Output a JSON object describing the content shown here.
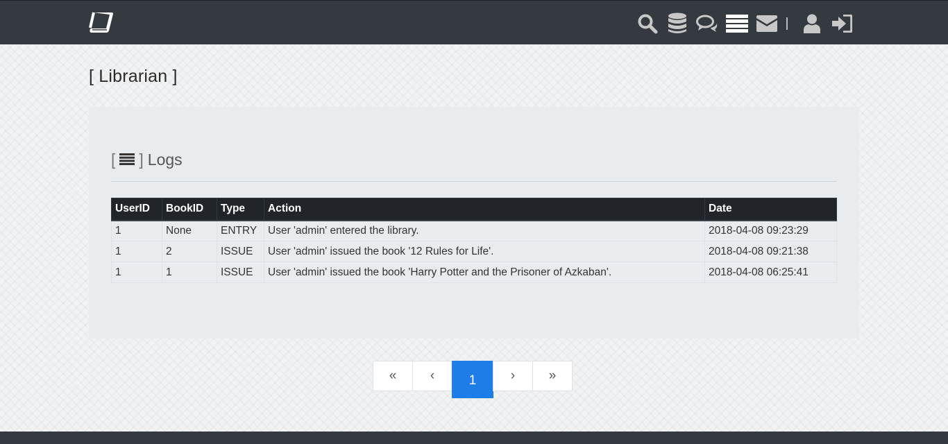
{
  "navbar": {
    "icons": [
      "book-logo-icon",
      "search-icon",
      "database-icon",
      "comments-icon",
      "list-icon",
      "envelope-icon",
      "user-icon",
      "sign-in-icon"
    ],
    "separator": "|"
  },
  "page": {
    "title": "[ Librarian ]"
  },
  "logs": {
    "open_bracket": "[",
    "close_bracket": "]",
    "title": "Logs",
    "columns": [
      "UserID",
      "BookID",
      "Type",
      "Action",
      "Date"
    ],
    "rows": [
      [
        "1",
        "None",
        "ENTRY",
        "User 'admin' entered the library.",
        "2018-04-08 09:23:29"
      ],
      [
        "1",
        "2",
        "ISSUE",
        "User 'admin' issued the book '12 Rules for Life'.",
        "2018-04-08 09:21:38"
      ],
      [
        "1",
        "1",
        "ISSUE",
        "User 'admin' issued the book 'Harry Potter and the Prisoner of Azkaban'.",
        "2018-04-08 06:25:41"
      ]
    ]
  },
  "pagination": {
    "first": "«",
    "prev": "‹",
    "current": "1",
    "next": "›",
    "last": "»"
  },
  "colors": {
    "navbar": "#343a40",
    "panel": "#e9ecef",
    "table_header": "#212529",
    "active_page": "#1e7de6"
  }
}
